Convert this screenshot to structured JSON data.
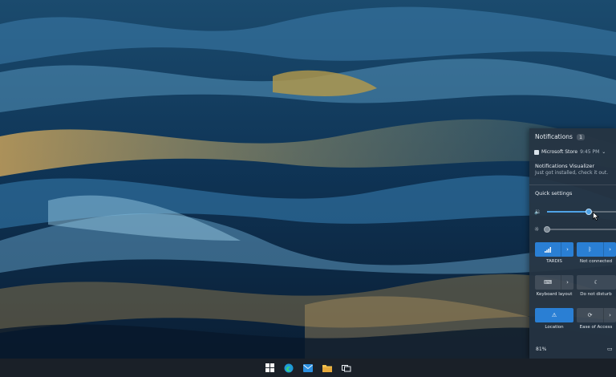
{
  "notifications": {
    "header": "Notifications",
    "count": "1",
    "app_name": "Microsoft Store",
    "time": "9:45 PM",
    "title": "Notifications Visualizer",
    "body": "Just got installed, check it out."
  },
  "quick_settings": {
    "header": "Quick settings",
    "volume_level": 0.6,
    "brightness_level": 0.0,
    "tiles": [
      {
        "label": "TARDIS",
        "state": "on",
        "icon": "wifi-icon"
      },
      {
        "label": "Not connected",
        "state": "on",
        "icon": "bluetooth-icon"
      },
      {
        "label": "Keyboard layout",
        "state": "off",
        "icon": "keyboard-icon"
      },
      {
        "label": "Do not disturb",
        "state": "off",
        "icon": "moon-icon"
      },
      {
        "label": "Location",
        "state": "on",
        "icon": "location-icon"
      },
      {
        "label": "Ease of Access",
        "state": "off",
        "icon": "accessibility-icon"
      }
    ],
    "battery": "81%"
  },
  "taskbar": {
    "icons": [
      "windows-start-icon",
      "edge-icon",
      "mail-icon",
      "file-explorer-icon",
      "task-view-icon"
    ]
  },
  "colors": {
    "accent": "#2a7fd4",
    "panel": "#263442",
    "taskbar": "#1a2028"
  }
}
